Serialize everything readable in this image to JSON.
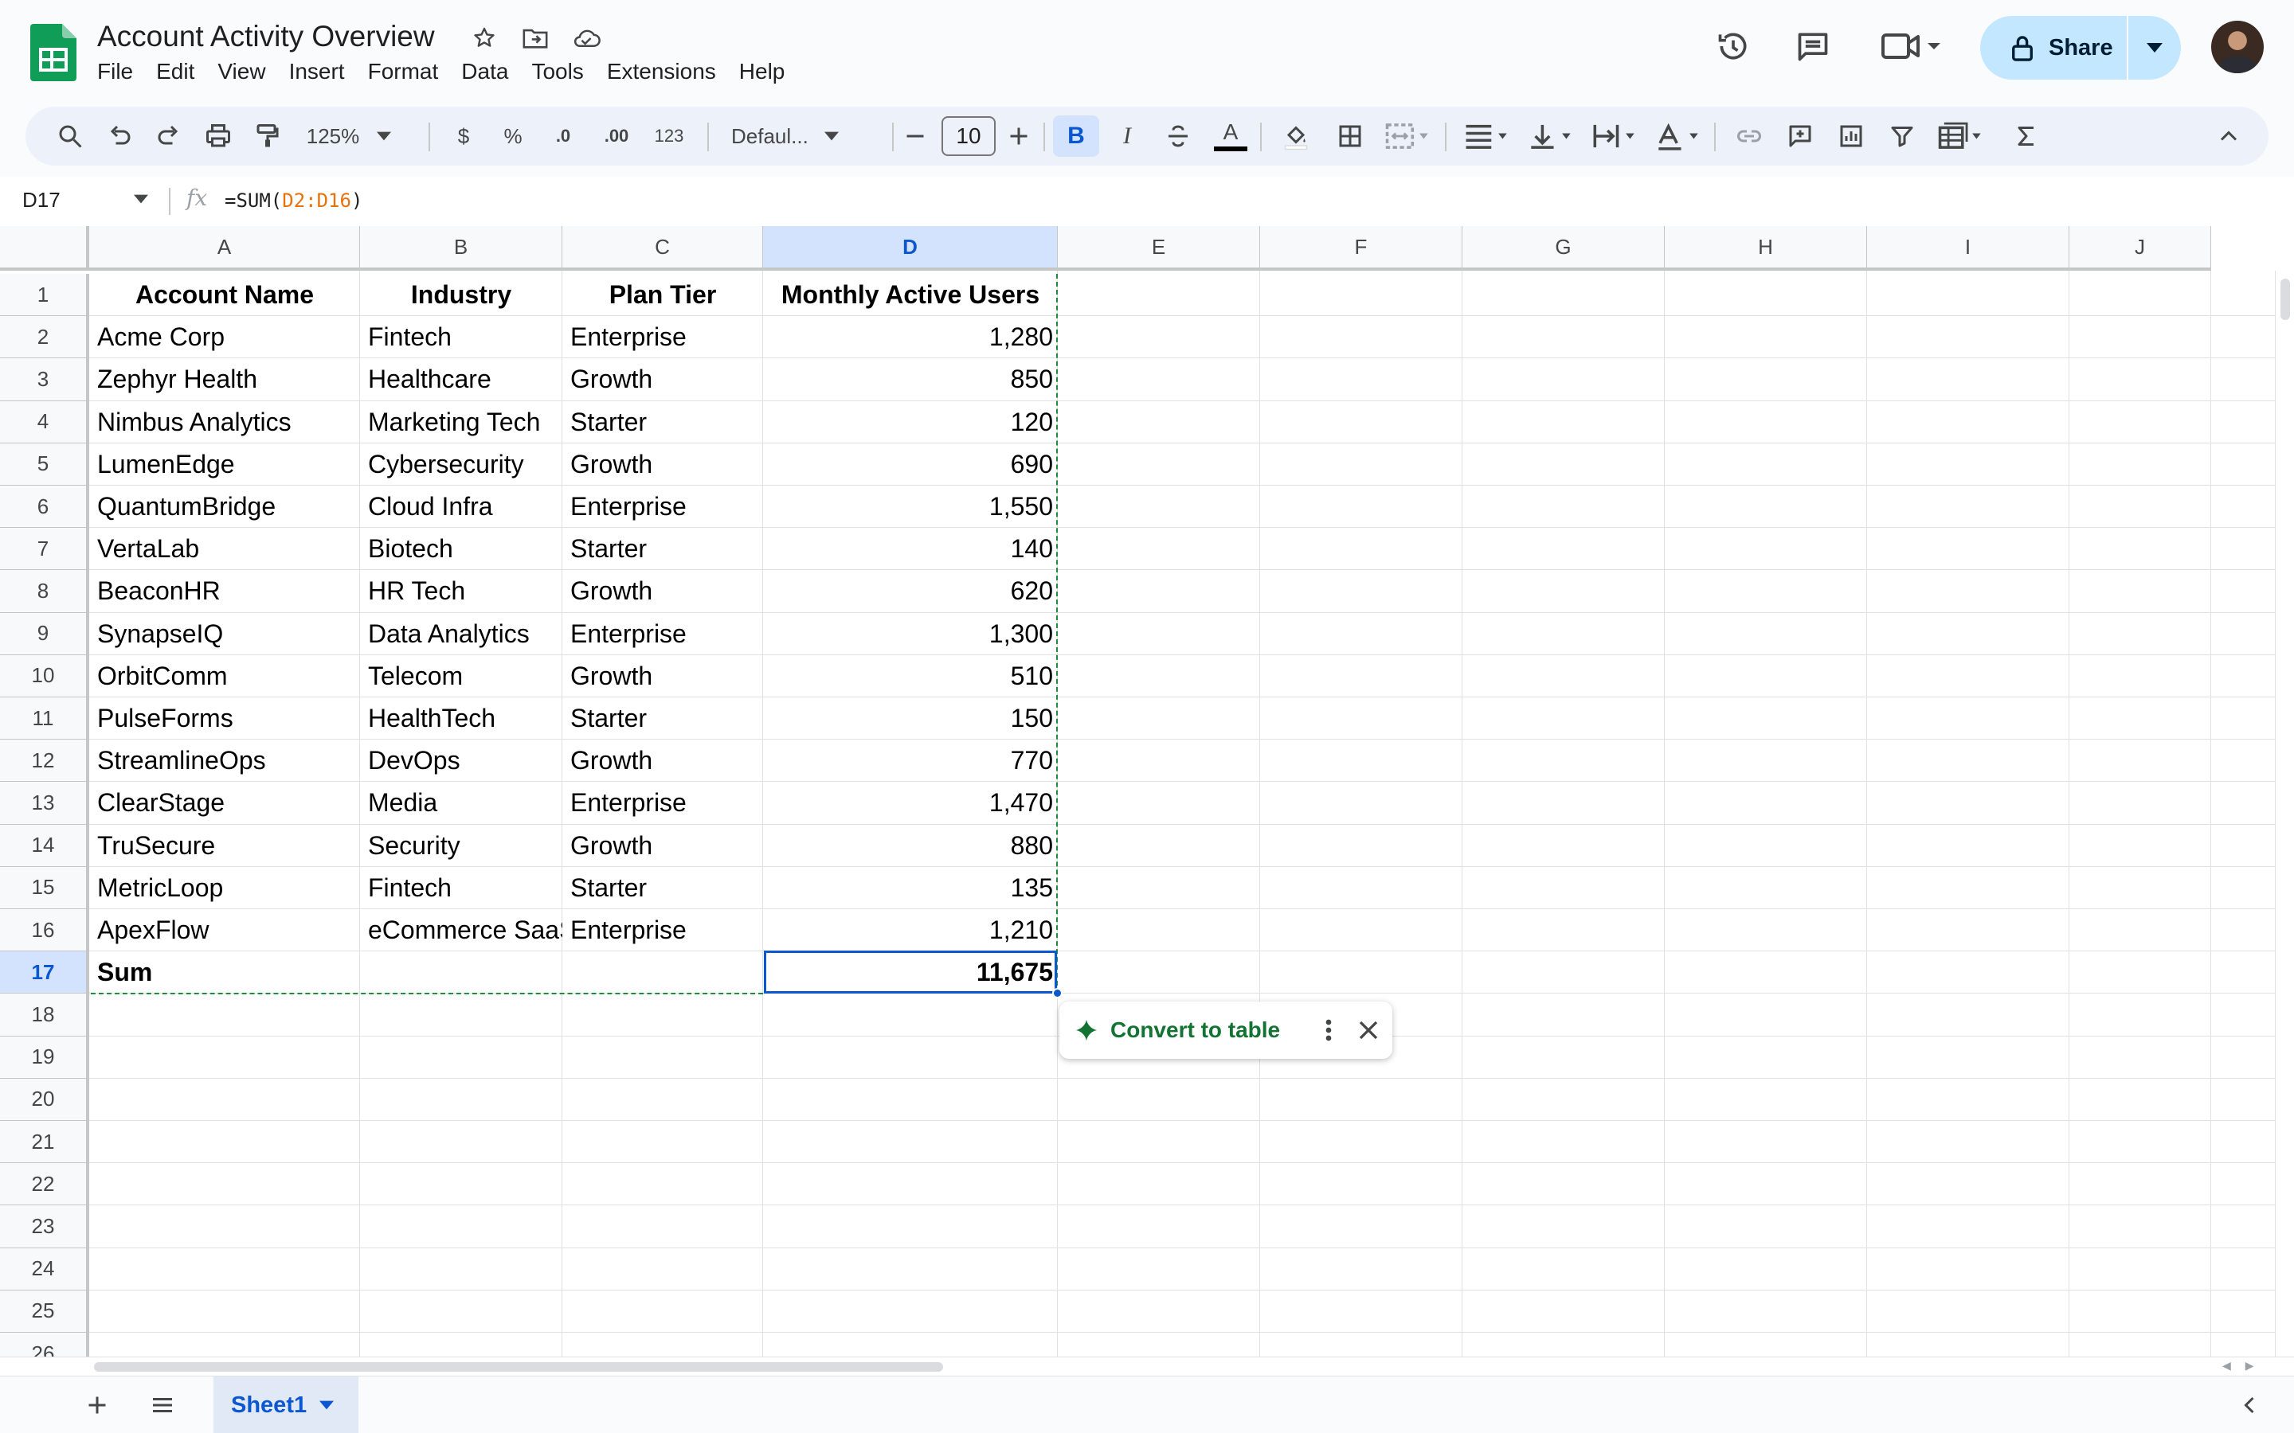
{
  "app": {
    "doc_title": "Account Activity Overview",
    "menus": [
      "File",
      "Edit",
      "View",
      "Insert",
      "Format",
      "Data",
      "Tools",
      "Extensions",
      "Help"
    ],
    "share_label": "Share",
    "icons": [
      "sheets-logo-icon",
      "star-icon",
      "move-folder-icon",
      "cloud-status-icon",
      "version-history-icon",
      "comments-icon",
      "meet-icon",
      "lock-icon",
      "avatar"
    ]
  },
  "toolbar": {
    "zoom": "125%",
    "currency": "$",
    "percent": "%",
    "decrease_decimal": ".0",
    "increase_decimal": ".00",
    "number_format": "123",
    "font": "Defaul...",
    "font_size": "10",
    "bold": "B",
    "italic": "I",
    "text_color": "A"
  },
  "formula_bar": {
    "name_box": "D17",
    "fx": "fx",
    "formula_prefix": "=SUM(",
    "formula_ref": "D2:D16",
    "formula_suffix": ")"
  },
  "grid": {
    "columns": [
      "A",
      "B",
      "C",
      "D",
      "E",
      "F",
      "G",
      "H",
      "I",
      "J"
    ],
    "selected_column": "D",
    "rows_visible": [
      "1",
      "2",
      "3",
      "4",
      "5",
      "6",
      "7",
      "8",
      "9",
      "10",
      "11",
      "12",
      "13",
      "14",
      "15",
      "16",
      "17",
      "18",
      "19",
      "20",
      "21",
      "22",
      "23",
      "24",
      "25",
      "26"
    ],
    "selected_row": "17",
    "header_row": [
      "Account Name",
      "Industry",
      "Plan Tier",
      "Monthly Active Users"
    ],
    "data_rows": [
      [
        "Acme Corp",
        "Fintech",
        "Enterprise",
        "1,280"
      ],
      [
        "Zephyr Health",
        "Healthcare",
        "Growth",
        "850"
      ],
      [
        "Nimbus Analytics",
        "Marketing Tech",
        "Starter",
        "120"
      ],
      [
        "LumenEdge",
        "Cybersecurity",
        "Growth",
        "690"
      ],
      [
        "QuantumBridge",
        "Cloud Infra",
        "Enterprise",
        "1,550"
      ],
      [
        "VertaLab",
        "Biotech",
        "Starter",
        "140"
      ],
      [
        "BeaconHR",
        "HR Tech",
        "Growth",
        "620"
      ],
      [
        "SynapseIQ",
        "Data Analytics",
        "Enterprise",
        "1,300"
      ],
      [
        "OrbitComm",
        "Telecom",
        "Growth",
        "510"
      ],
      [
        "PulseForms",
        "HealthTech",
        "Starter",
        "150"
      ],
      [
        "StreamlineOps",
        "DevOps",
        "Growth",
        "770"
      ],
      [
        "ClearStage",
        "Media",
        "Enterprise",
        "1,470"
      ],
      [
        "TruSecure",
        "Security",
        "Growth",
        "880"
      ],
      [
        "MetricLoop",
        "Fintech",
        "Starter",
        "135"
      ],
      [
        "ApexFlow",
        "eCommerce SaaS",
        "Enterprise",
        "1,210"
      ]
    ],
    "sum_row": [
      "Sum",
      "",
      "",
      "11,675"
    ]
  },
  "chip": {
    "label": "Convert to table"
  },
  "sheets": {
    "tabs": [
      "Sheet1"
    ]
  },
  "colors": {
    "accent": "#0b57d0",
    "selection_bg": "#d3e3fd",
    "copy_border": "#1e8e3e",
    "share_bg": "#c2e7ff",
    "formula_ref": "#e8710a"
  }
}
